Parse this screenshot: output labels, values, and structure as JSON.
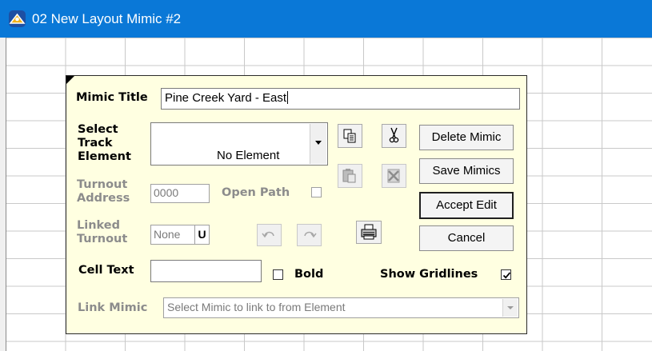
{
  "window": {
    "title": "02 New Layout Mimic #2"
  },
  "dialog": {
    "mimic_title": {
      "label": "Mimic Title",
      "value": "Pine Creek Yard - East"
    },
    "select_track_element": {
      "label_line1": "Select",
      "label_line2": "Track",
      "label_line3": "Element",
      "value": "No Element"
    },
    "turnout_address": {
      "label_line1": "Turnout",
      "label_line2": "Address",
      "value": "0000"
    },
    "open_path": {
      "label": "Open Path",
      "checked": false
    },
    "linked_turnout": {
      "label_line1": "Linked",
      "label_line2": "Turnout",
      "value": "None",
      "suffix": "U"
    },
    "cell_text": {
      "label": "Cell Text",
      "value": ""
    },
    "bold": {
      "label": "Bold",
      "checked": false
    },
    "show_gridlines": {
      "label": "Show Gridlines",
      "checked": true
    },
    "link_mimic": {
      "label": "Link Mimic",
      "placeholder": "Select Mimic to link to from Element"
    },
    "buttons": {
      "delete_mimic": "Delete Mimic",
      "save_mimics": "Save Mimics",
      "accept_edit": "Accept Edit",
      "cancel": "Cancel"
    },
    "icons": {
      "copy": "copy-icon",
      "cut": "cut-icon",
      "paste": "paste-icon",
      "delete_element": "delete-icon",
      "undo": "undo-icon",
      "redo": "redo-icon",
      "print": "printer-icon",
      "dropdown": "chevron-down-icon"
    }
  }
}
